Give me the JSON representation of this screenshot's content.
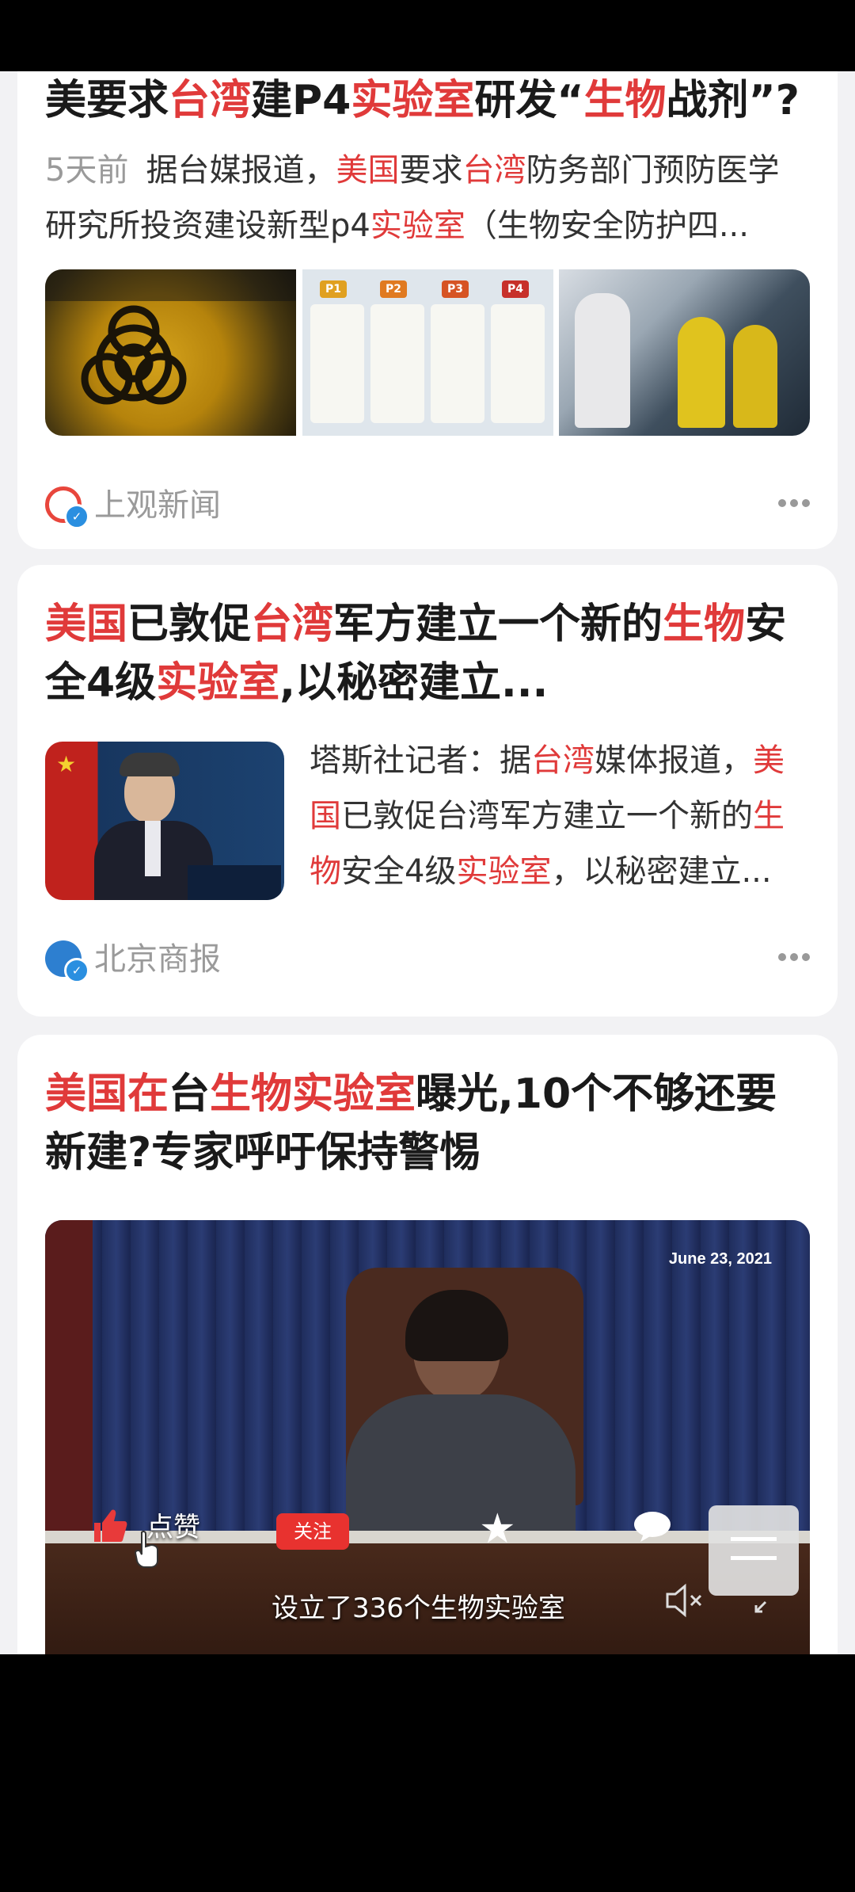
{
  "cards": [
    {
      "title_parts": [
        {
          "text": "美要求",
          "hl": false
        },
        {
          "text": "台湾",
          "hl": true
        },
        {
          "text": "建P4",
          "hl": false
        },
        {
          "text": "实验室",
          "hl": true
        },
        {
          "text": "研发“",
          "hl": false
        },
        {
          "text": "生物",
          "hl": true
        },
        {
          "text": "战剂”?",
          "hl": false
        }
      ],
      "time": "5天前",
      "snippet_parts": [
        {
          "text": "据台媒报道，",
          "hl": false
        },
        {
          "text": "美国",
          "hl": true
        },
        {
          "text": "要求",
          "hl": false
        },
        {
          "text": "台湾",
          "hl": true
        },
        {
          "text": "防务部门预防医学研究所投资建设新型p4",
          "hl": false
        },
        {
          "text": "实验室",
          "hl": true
        },
        {
          "text": "（生物安全防护四...",
          "hl": false
        }
      ],
      "images": [
        "biohazard-sign-photo",
        "pathogen-levels-infographic",
        "hazmat-workers-photo"
      ],
      "infographic_labels": [
        "P1",
        "P2",
        "P3",
        "P4"
      ],
      "source": "上观新闻"
    },
    {
      "title_parts": [
        {
          "text": "美国",
          "hl": true
        },
        {
          "text": "已敦促",
          "hl": false
        },
        {
          "text": "台湾",
          "hl": true
        },
        {
          "text": "军方建立一个新的",
          "hl": false
        },
        {
          "text": "生物",
          "hl": true
        },
        {
          "text": "安全4级",
          "hl": false
        },
        {
          "text": "实验室",
          "hl": true
        },
        {
          "text": ",以秘密建立...",
          "hl": false
        }
      ],
      "snippet_parts": [
        {
          "text": "塔斯社记者：据",
          "hl": false
        },
        {
          "text": "台湾",
          "hl": true
        },
        {
          "text": "媒体报道，",
          "hl": false
        },
        {
          "text": "美国",
          "hl": true
        },
        {
          "text": "已敦促台湾军方建立一个新的",
          "hl": false
        },
        {
          "text": "生物",
          "hl": true
        },
        {
          "text": "安全4级",
          "hl": false
        },
        {
          "text": "实验室",
          "hl": true
        },
        {
          "text": "，以秘密建立...",
          "hl": false
        }
      ],
      "source": "北京商报"
    },
    {
      "title_parts": [
        {
          "text": "美国在",
          "hl": true
        },
        {
          "text": "台",
          "hl": false
        },
        {
          "text": "生物实验室",
          "hl": true
        },
        {
          "text": "曝光,10个不够还要新建?专家呼吁保持警惕",
          "hl": false
        }
      ],
      "video": {
        "date": "June 23, 2021",
        "like_label": "点赞",
        "follow_label": "关注",
        "subtitle": "设立了336个生物实验室"
      }
    }
  ],
  "colors": {
    "highlight": "#e03a3a",
    "text": "#1a1a1a",
    "meta": "#9a9a9a",
    "follow": "#e8322f"
  }
}
